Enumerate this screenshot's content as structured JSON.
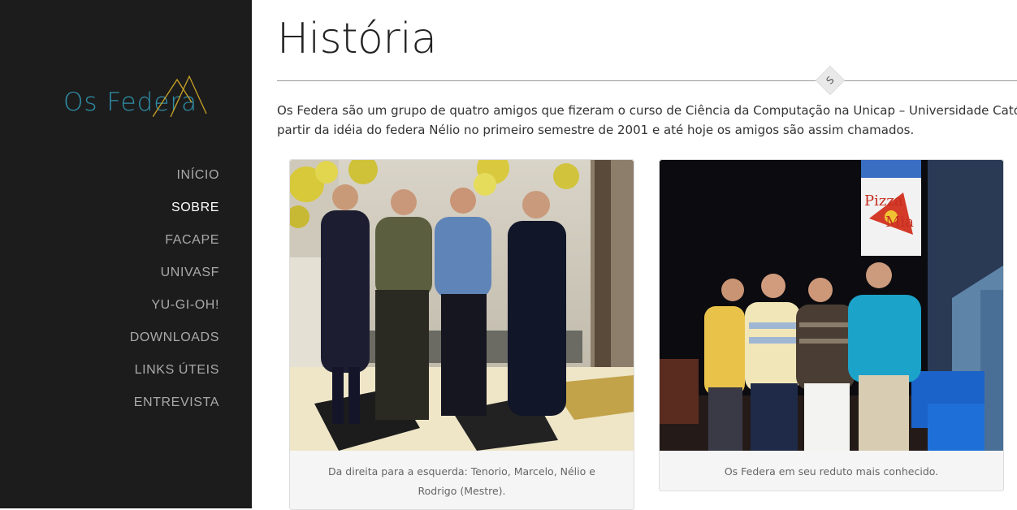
{
  "brand": {
    "logo_text": "Os Federa",
    "accent_color": "#2f8fa8",
    "logo_mark_color": "#c9a227"
  },
  "nav": {
    "items": [
      {
        "label": "INÍCIO",
        "active": false
      },
      {
        "label": "SOBRE",
        "active": true
      },
      {
        "label": "FACAPE",
        "active": false
      },
      {
        "label": "UNIVASF",
        "active": false
      },
      {
        "label": "YU-GI-OH!",
        "active": false
      },
      {
        "label": "DOWNLOADS",
        "active": false
      },
      {
        "label": "LINKS ÚTEIS",
        "active": false
      },
      {
        "label": "ENTREVISTA",
        "active": false
      }
    ]
  },
  "main": {
    "title": "História",
    "divider_icon": "S",
    "intro_line1": "Os Federa são um grupo de quatro amigos que fizeram o curso de Ciência da Computação na Unicap – Universidade Católica de",
    "intro_line2": "partir da idéia do federa Nélio no primeiro semestre de 2001 e até hoje os amigos são assim chamados.",
    "figures": [
      {
        "caption": "Da direita para a esquerda: Tenorio, Marcelo, Nélio e Rodrigo (Mestre)."
      },
      {
        "caption": "Os Federa em seu reduto mais conhecido.",
        "sign_line1": "Pizza",
        "sign_line2": "Mia"
      }
    ]
  }
}
